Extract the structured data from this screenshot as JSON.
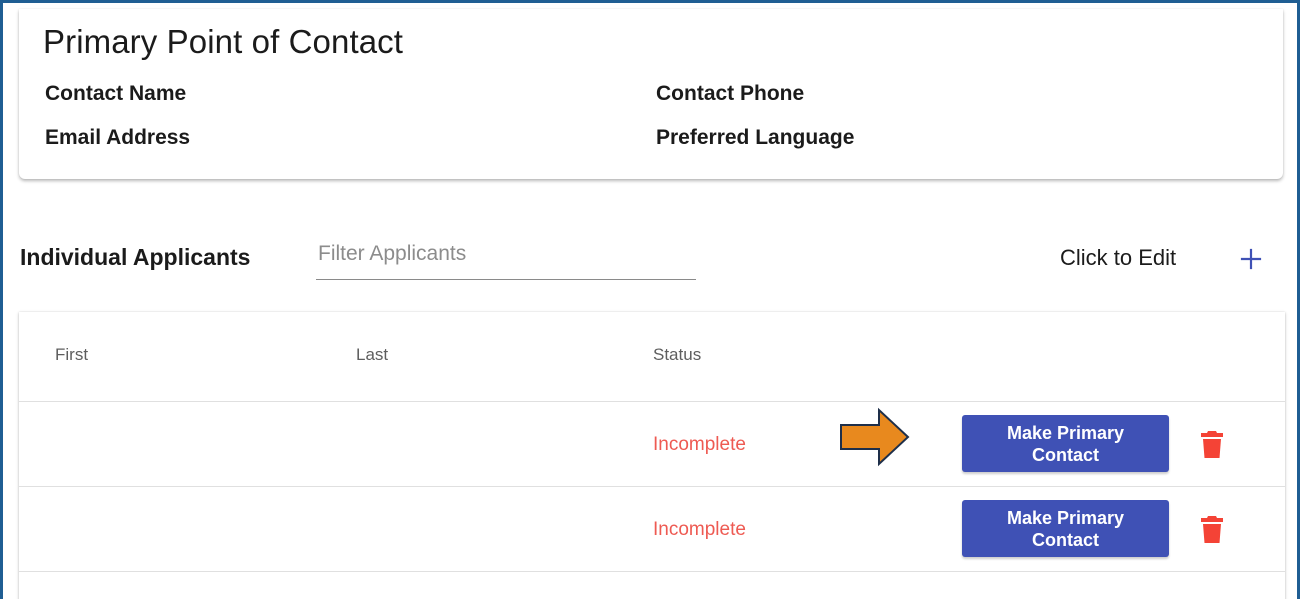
{
  "primary_contact": {
    "title": "Primary Point of Contact",
    "labels": {
      "contact_name": "Contact Name",
      "email_address": "Email Address",
      "contact_phone": "Contact Phone",
      "preferred_language": "Preferred Language"
    }
  },
  "applicants": {
    "section_title": "Individual Applicants",
    "filter_placeholder": "Filter Applicants",
    "filter_value": "",
    "click_to_edit": "Click to Edit",
    "add_icon": "plus-icon",
    "columns": {
      "first": "First",
      "last": "Last",
      "status": "Status"
    },
    "rows": [
      {
        "first": "",
        "last": "",
        "status": "Incomplete",
        "action_label": "Make Primary Contact",
        "delete_icon": "trash-icon"
      },
      {
        "first": "",
        "last": "",
        "status": "Incomplete",
        "action_label": "Make Primary Contact",
        "delete_icon": "trash-icon"
      }
    ]
  },
  "annotation": {
    "icon": "arrow-right-icon",
    "color": "#e8891e"
  },
  "colors": {
    "frame_border": "#1f5e93",
    "button_bg": "#3f51b5",
    "status_incomplete": "#ee5a52",
    "trash": "#f44336",
    "accent": "#3f51b5"
  }
}
